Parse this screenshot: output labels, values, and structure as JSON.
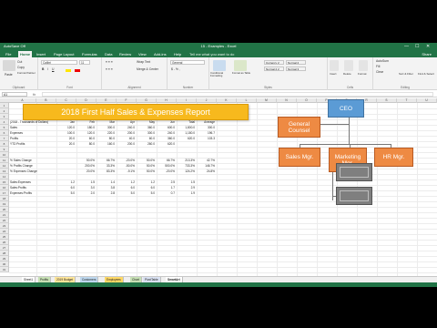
{
  "window": {
    "title": "15 - Examples - Excel",
    "quick_access": "AutoSave  Off",
    "controls": [
      "—",
      "☐",
      "✕"
    ]
  },
  "ribbon_tabs": [
    "File",
    "Home",
    "Insert",
    "Page Layout",
    "Formulas",
    "Data",
    "Review",
    "View",
    "Add-ins",
    "Help"
  ],
  "tell_me": "Tell me what you want to do",
  "share": "Share",
  "ribbon": {
    "clipboard": {
      "label": "Clipboard",
      "paste": "Paste",
      "cut": "Cut",
      "copy": "Copy",
      "format_painter": "Format Painter"
    },
    "font": {
      "label": "Font",
      "font_name": "Calibri",
      "font_size": "11"
    },
    "alignment": {
      "label": "Alignment",
      "wrap": "Wrap Text",
      "merge": "Merge & Center"
    },
    "number": {
      "label": "Number",
      "format": "General"
    },
    "styles": {
      "label": "Styles",
      "conditional": "Conditional Formatting",
      "format_table": "Format as Table",
      "cells": [
        "Currency 2",
        "Normal 2",
        "Normal 2 2",
        "Normal 3"
      ]
    },
    "cells": {
      "label": "Cells",
      "insert": "Insert",
      "delete": "Delete",
      "format": "Format"
    },
    "editing": {
      "label": "Editing",
      "autosum": "AutoSum",
      "fill": "Fill",
      "clear": "Clear",
      "sort": "Sort & Filter",
      "find": "Find & Select"
    }
  },
  "formula_bar": {
    "name_box": "A1",
    "fx": "fx"
  },
  "columns": [
    "A",
    "B",
    "C",
    "D",
    "E",
    "F",
    "G",
    "H",
    "I",
    "J",
    "K",
    "L",
    "M",
    "N",
    "O",
    "P",
    "Q",
    "R",
    "S",
    "T",
    "U"
  ],
  "rows": [
    "1",
    "2",
    "3",
    "4",
    "5",
    "6",
    "7",
    "8",
    "9",
    "10",
    "11",
    "12",
    "13",
    "14",
    "15",
    "16",
    "17",
    "18",
    "19",
    "20",
    "21",
    "22",
    "23",
    "24",
    "25",
    "26",
    "27",
    "28",
    "29",
    "30",
    "31"
  ],
  "banner_title": "2018 First Half Sales & Expenses Report",
  "table": {
    "caption": "(2018 - Thousands of Dollars)",
    "headers": [
      "Jan",
      "Feb",
      "Mar",
      "Apr",
      "May",
      "Jun",
      "Total",
      "Average"
    ],
    "rows": [
      {
        "label": "Sales",
        "cur": true,
        "values": [
          "120.0",
          "180.0",
          "300.0",
          "240.0",
          "360.0",
          "600.0",
          "1,800.0",
          "300.0"
        ]
      },
      {
        "label": "Expenses",
        "cur": false,
        "values": [
          "100.0",
          "120.0",
          "220.0",
          "200.0",
          "300.0",
          "240.0",
          "1,180.0",
          "196.7"
        ]
      },
      {
        "label": "Profits",
        "cur": false,
        "values": [
          "20.0",
          "60.0",
          "80.0",
          "40.0",
          "60.0",
          "360.0",
          "620.0",
          "103.3"
        ]
      },
      {
        "label": "YTD Profits",
        "cur": true,
        "values": [
          "20.0",
          "80.0",
          "160.0",
          "200.0",
          "260.0",
          "620.0",
          "",
          ""
        ]
      }
    ],
    "pct_rows": [
      {
        "label": "% Sales Change",
        "values": [
          "",
          "50.0%",
          "66.7%",
          "-20.0%",
          "50.0%",
          "66.7%",
          "213.3%",
          "42.7%"
        ]
      },
      {
        "label": "% Profits Change",
        "values": [
          "",
          "200.0%",
          "33.3%",
          "-50.0%",
          "50.0%",
          "500.0%",
          "733.3%",
          "146.7%"
        ]
      },
      {
        "label": "% Expenses Change",
        "values": [
          "",
          "20.0%",
          "83.3%",
          "-9.1%",
          "50.0%",
          "-20.0%",
          "124.2%",
          "24.8%"
        ]
      }
    ],
    "ratio_rows": [
      {
        "label": "Sales:Expenses",
        "values": [
          "1.2",
          "1.5",
          "1.4",
          "1.2",
          "1.2",
          "2.5",
          "1.5",
          ""
        ]
      },
      {
        "label": "Sales:Profits",
        "values": [
          "6.0",
          "3.0",
          "3.8",
          "6.0",
          "6.0",
          "1.7",
          "2.9",
          ""
        ]
      },
      {
        "label": "Expenses:Profits",
        "values": [
          "5.0",
          "2.0",
          "2.8",
          "5.0",
          "5.0",
          "0.7",
          "1.9",
          ""
        ]
      }
    ]
  },
  "org_chart": {
    "ceo": "CEO",
    "counsel": "General Counsel",
    "sales": "Sales Mgr.",
    "marketing": "Marketing Mgr.",
    "hr": "HR Mgr."
  },
  "sheet_tabs": [
    "Sheet1",
    "Profits",
    "2019 Budget",
    "Customers",
    "Employees",
    "Chart",
    "PivotTable",
    "SmartArt"
  ],
  "colors": {
    "excel_green": "#217346",
    "banner": "#f7b91d",
    "org_orange": "#ee8a43",
    "org_blue": "#5b9bd5",
    "org_gray": "#7f7f7f"
  }
}
